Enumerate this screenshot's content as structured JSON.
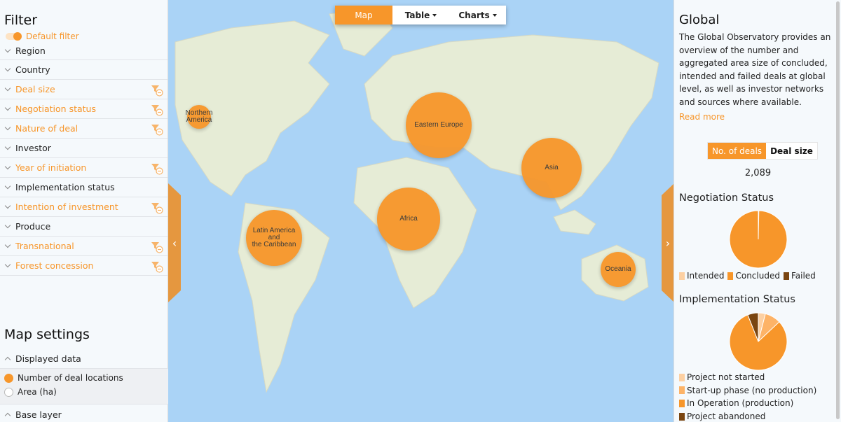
{
  "view_tabs": [
    {
      "label": "Map",
      "active": true,
      "dropdown": false
    },
    {
      "label": "Table",
      "active": false,
      "dropdown": true
    },
    {
      "label": "Charts",
      "active": false,
      "dropdown": true
    }
  ],
  "filter_panel": {
    "title": "Filter",
    "default_filter": {
      "label": "Default filter",
      "on": true
    },
    "items": [
      {
        "label": "Region",
        "active": false
      },
      {
        "label": "Country",
        "active": false
      },
      {
        "label": "Deal size",
        "active": true
      },
      {
        "label": "Negotiation status",
        "active": true
      },
      {
        "label": "Nature of deal",
        "active": true
      },
      {
        "label": "Investor",
        "active": false
      },
      {
        "label": "Year of initiation",
        "active": true
      },
      {
        "label": "Implementation status",
        "active": false
      },
      {
        "label": "Intention of investment",
        "active": true
      },
      {
        "label": "Produce",
        "active": false
      },
      {
        "label": "Transnational",
        "active": true
      },
      {
        "label": "Forest concession",
        "active": true
      }
    ]
  },
  "map_settings": {
    "title": "Map settings",
    "displayed_data_label": "Displayed data",
    "options": [
      {
        "label": "Number of deal locations",
        "selected": true
      },
      {
        "label": "Area (ha)",
        "selected": false
      }
    ],
    "base_layer_label": "Base layer"
  },
  "map": {
    "bubble_color": "#f7962a",
    "regions": [
      {
        "name": "Northern America",
        "line1": "Northern",
        "line2": "America",
        "relative_size": 0.2
      },
      {
        "name": "Latin America and the Caribbean",
        "line1": "Latin America and",
        "line2": "the Caribbean",
        "relative_size": 0.85
      },
      {
        "name": "Africa",
        "line1": "Africa",
        "line2": "",
        "relative_size": 0.95
      },
      {
        "name": "Eastern Europe",
        "line1": "Eastern Europe",
        "line2": "",
        "relative_size": 1.0
      },
      {
        "name": "Asia",
        "line1": "Asia",
        "line2": "",
        "relative_size": 0.92
      },
      {
        "name": "Oceania",
        "line1": "Oceania",
        "line2": "",
        "relative_size": 0.53
      }
    ],
    "collapse_left_icon": "chevron-left-icon",
    "collapse_right_icon": "chevron-right-icon"
  },
  "info_panel": {
    "title": "Global",
    "description": "The Global Observatory provides an overview of the number and aggregated area size of concluded, intended and failed deals at global level, as well as investor networks and sources where available.",
    "read_more": "Read more",
    "metric_toggle": [
      {
        "label": "No. of deals",
        "active": true
      },
      {
        "label": "Deal size",
        "active": false
      }
    ],
    "total": "2,089"
  },
  "chart_data": [
    {
      "type": "pie",
      "title": "Negotiation Status",
      "categories": [
        "Intended",
        "Concluded",
        "Failed"
      ],
      "values": [
        0.3,
        99.7,
        0
      ],
      "colors": [
        "#fdd0a2",
        "#f7962a",
        "#7a4510"
      ],
      "legend": "bottom"
    },
    {
      "type": "pie",
      "title": "Implementation Status",
      "categories": [
        "Project not started",
        "Start-up phase (no production)",
        "In Operation (production)",
        "Project abandoned"
      ],
      "values": [
        4,
        9,
        81,
        6
      ],
      "colors": [
        "#fdd0a2",
        "#fdb367",
        "#f7962a",
        "#7a4510"
      ],
      "legend": "bottom"
    }
  ]
}
